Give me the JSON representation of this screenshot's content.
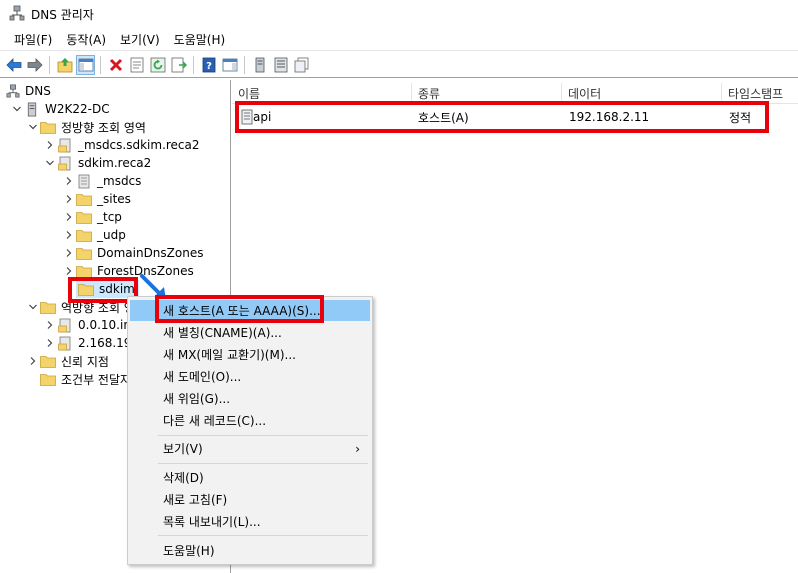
{
  "window": {
    "title": "DNS 관리자"
  },
  "menubar": [
    "파일(F)",
    "동작(A)",
    "보기(V)",
    "도움말(H)"
  ],
  "toolbar": {
    "buttons": [
      "back-icon",
      "forward-icon",
      "up-folder-icon",
      "show-hide-tree-icon",
      "delete-icon",
      "properties-icon",
      "refresh-icon",
      "export-list-icon",
      "help-icon",
      "show-hide-action-pane-icon",
      "server-icon",
      "zone-list-icon",
      "copy-icon"
    ]
  },
  "tree": {
    "root": "DNS",
    "server": "W2K22-DC",
    "forward_zones": "정방향 조회 영역",
    "zone1": "_msdcs.sdkim.reca2",
    "zone2": "sdkim.reca2",
    "children": [
      "_msdcs",
      "_sites",
      "_tcp",
      "_udp",
      "DomainDnsZones",
      "ForestDnsZones",
      "sdkim"
    ],
    "reverse_zones": "역방향 조회 영역",
    "rev1": "0.0.10.in",
    "rev2": "2.168.19",
    "trust_points": "신뢰 지점",
    "cond_forwarders": "조건부 전달자"
  },
  "list": {
    "columns": [
      "이름",
      "종류",
      "데이터",
      "타임스탬프"
    ],
    "rows": [
      {
        "name": "api",
        "type": "호스트(A)",
        "data": "192.168.2.11",
        "timestamp": "정적"
      }
    ]
  },
  "context_menu": {
    "items": [
      "새 호스트(A 또는 AAAA)(S)...",
      "새 별칭(CNAME)(A)...",
      "새 MX(메일 교환기)(M)...",
      "새 도메인(O)...",
      "새 위임(G)...",
      "다른 새 레코드(C)..."
    ],
    "view": "보기(V)",
    "submenu_arrow": "›",
    "actions": [
      "삭제(D)",
      "새로 고침(F)",
      "목록 내보내기(L)..."
    ],
    "help": "도움말(H)"
  },
  "colors": {
    "highlight": "#91c9f7",
    "annotation_red": "#e8000b",
    "annotation_arrow": "#1a73d9",
    "folder": "#f5d36b"
  }
}
